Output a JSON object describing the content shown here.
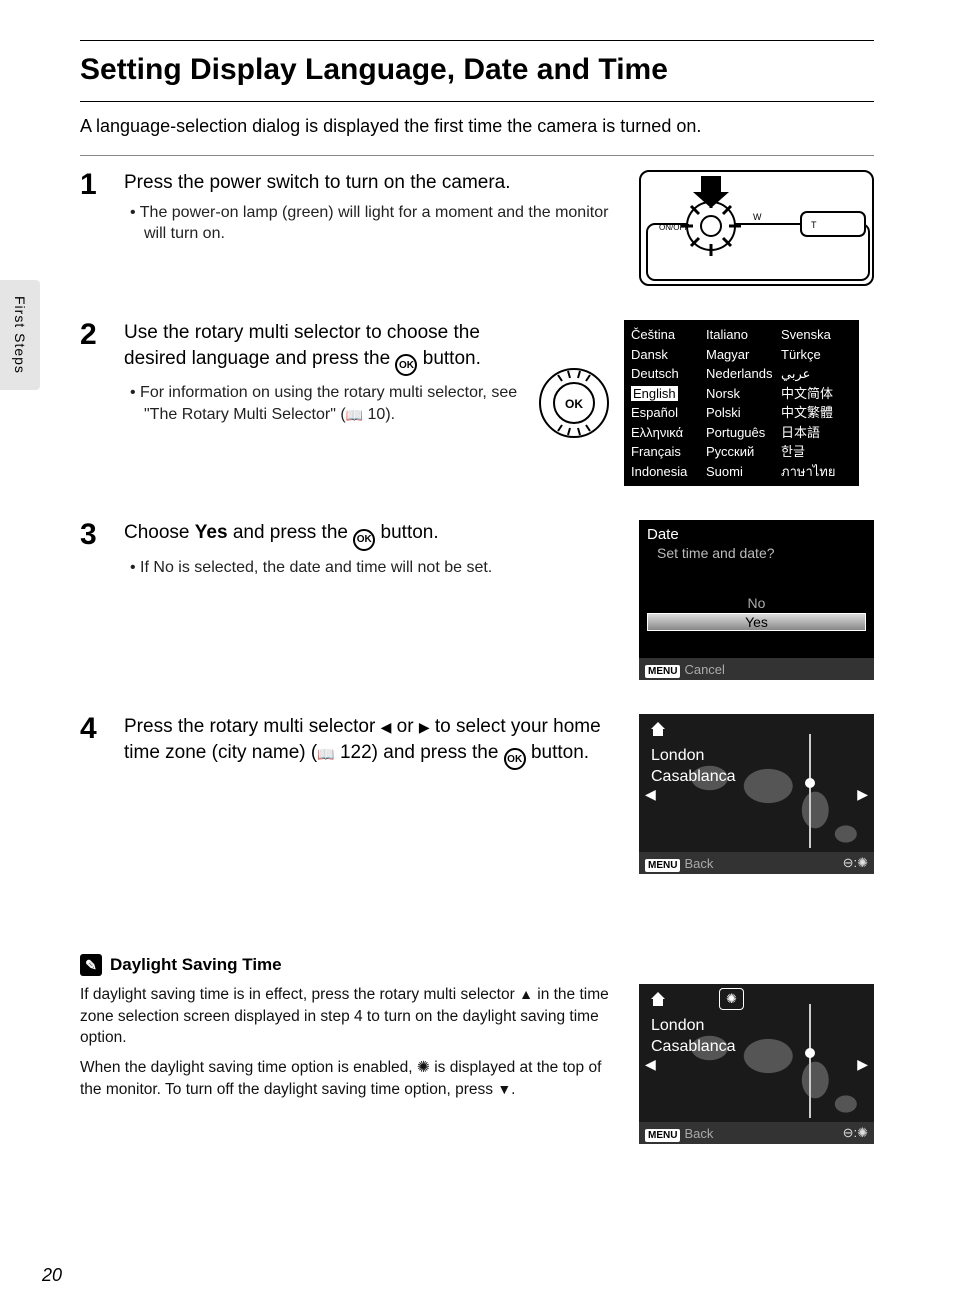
{
  "side_tab": "First Steps",
  "title": "Setting Display Language, Date and Time",
  "intro": "A language-selection dialog is displayed the first time the camera is turned on.",
  "page_number": "20",
  "steps": {
    "s1": {
      "num": "1",
      "head": "Press the power switch to turn on the camera.",
      "bullet": "The power-on lamp (green) will light for a moment and the monitor will turn on.",
      "fig_onoff": "ON/OFF",
      "fig_w": "W",
      "fig_t": "T"
    },
    "s2": {
      "num": "2",
      "head_a": "Use the rotary multi selector to choose the desired language and press the ",
      "head_b": " button.",
      "bullet_a": "For information on using the rotary multi selector, see \"The Rotary Multi Selector\" (",
      "bullet_ref": " 10).",
      "ok": "OK",
      "languages": {
        "col1": [
          "Čeština",
          "Dansk",
          "Deutsch",
          "English",
          "Español",
          "Ελληνικά",
          "Français",
          "Indonesia"
        ],
        "col2": [
          "Italiano",
          "Magyar",
          "Nederlands",
          "Norsk",
          "Polski",
          "Português",
          "Русский",
          "Suomi"
        ],
        "col3": [
          "Svenska",
          "Türkçe",
          "عربي",
          "中文简体",
          "中文繁體",
          "日本語",
          "한글",
          "ภาษาไทย"
        ]
      }
    },
    "s3": {
      "num": "3",
      "head_a": "Choose ",
      "head_yes": "Yes",
      "head_b": " and press the ",
      "head_c": " button.",
      "bullet_a": "If ",
      "bullet_no": "No",
      "bullet_b": " is selected, the date and time will not be set.",
      "screen": {
        "title": "Date",
        "question": "Set time and date?",
        "no": "No",
        "yes": "Yes",
        "menu": "MENU",
        "cancel": "Cancel"
      }
    },
    "s4": {
      "num": "4",
      "head_a": "Press the rotary multi selector ",
      "head_b": " or ",
      "head_c": " to select your home time zone (city name) (",
      "head_ref": " 122) and press the ",
      "head_d": " button.",
      "screen": {
        "city1": "London",
        "city2": "Casablanca",
        "menu": "MENU",
        "back": "Back",
        "dst_corner": "⊖:✺"
      }
    }
  },
  "note": {
    "heading": "Daylight Saving Time",
    "p1_a": "If daylight saving time is in effect, press the rotary multi selector ",
    "p1_b": " in the time zone selection screen displayed in step 4 to turn on the daylight saving time option.",
    "p2_a": "When the daylight saving time option is enabled, ",
    "p2_b": " is displayed at the top of the monitor. To turn off the daylight saving time option, press ",
    "p2_c": ".",
    "dst_icon": "✺",
    "screen": {
      "city1": "London",
      "city2": "Casablanca",
      "menu": "MENU",
      "back": "Back",
      "dst_ind": "✺",
      "dst_corner": "⊖:✺"
    }
  }
}
